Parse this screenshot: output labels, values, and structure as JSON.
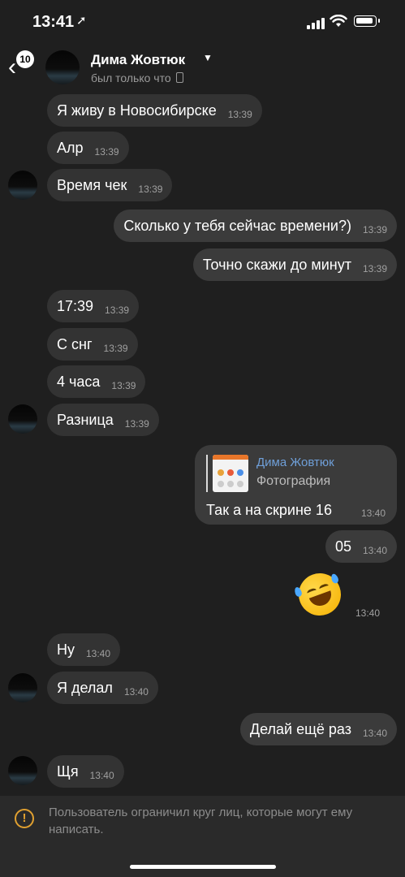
{
  "status_bar": {
    "time": "13:41",
    "location_arrow": "location-arrow-icon"
  },
  "header": {
    "unread_count": "10",
    "contact_name": "Дима Жовтюк",
    "status": "был только что"
  },
  "messages": [
    {
      "text": "Я живу в Новосибирске",
      "time": "13:39"
    },
    {
      "text": "Алр",
      "time": "13:39"
    },
    {
      "text": "Время чек",
      "time": "13:39"
    },
    {
      "text": "Сколько у тебя сейчас времени?)",
      "time": "13:39"
    },
    {
      "text": "Точно скажи до минут",
      "time": "13:39"
    },
    {
      "text": "17:39",
      "time": "13:39"
    },
    {
      "text": "С снг",
      "time": "13:39"
    },
    {
      "text": "4 часа",
      "time": "13:39"
    },
    {
      "text": "Разница",
      "time": "13:39"
    },
    {
      "reply_to_name": "Дима Жовтюк",
      "reply_to_type": "Фотография",
      "text": "Так а на скрине 16",
      "time": "13:40"
    },
    {
      "text": "05",
      "time": "13:40"
    },
    {
      "emoji": "rolling-on-floor-laughing-emoji",
      "time": "13:40"
    },
    {
      "text": "Ну",
      "time": "13:40"
    },
    {
      "text": "Я делал",
      "time": "13:40"
    },
    {
      "text": "Делай ещё раз",
      "time": "13:40"
    },
    {
      "text": "Щя",
      "time": "13:40"
    }
  ],
  "footer": {
    "notice": "Пользователь ограничил круг лиц, которые могут ему написать.",
    "icon": "warning-icon"
  },
  "colors": {
    "background": "#1f1f1f",
    "bubble": "#333333",
    "reply_name": "#6f9fd8",
    "warning": "#e0a030"
  }
}
